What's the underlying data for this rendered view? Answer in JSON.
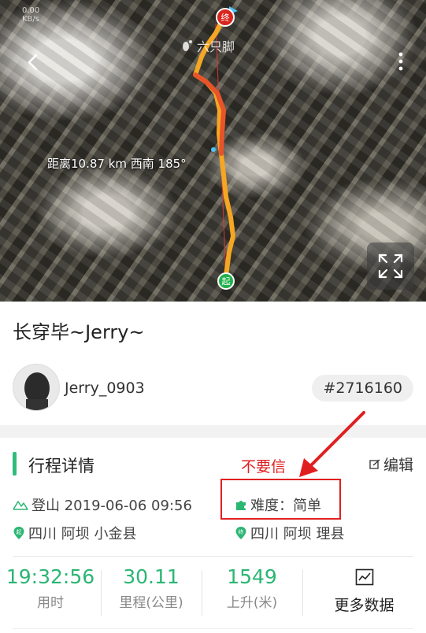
{
  "map": {
    "status_text": "0.00\nKB/s",
    "watermark": "六只脚",
    "distance_label": "距离10.87 km 西南 185°",
    "start_marker": "起",
    "end_marker": "终"
  },
  "trip": {
    "title": "长穿毕~Jerry~",
    "username": "Jerry_0903",
    "route_id": "#2716160"
  },
  "details": {
    "section_title": "行程详情",
    "annotation": "不要信",
    "edit_label": "编辑",
    "activity": "登山 2019-06-06 09:56",
    "difficulty": "难度：简单",
    "start_location": "四川 阿坝 小金县",
    "end_location": "四川 阿坝 理县"
  },
  "stats": [
    {
      "value": "19:32:56",
      "label": "用时"
    },
    {
      "value": "30.11",
      "label": "里程(公里)"
    },
    {
      "value": "1549",
      "label": "上升(米)"
    }
  ],
  "more_data_label": "更多数据",
  "colors": {
    "accent_green": "#2bb673",
    "route_orange": "#f5a623",
    "route_red": "#e8542a",
    "annotation_red": "#e02020"
  }
}
